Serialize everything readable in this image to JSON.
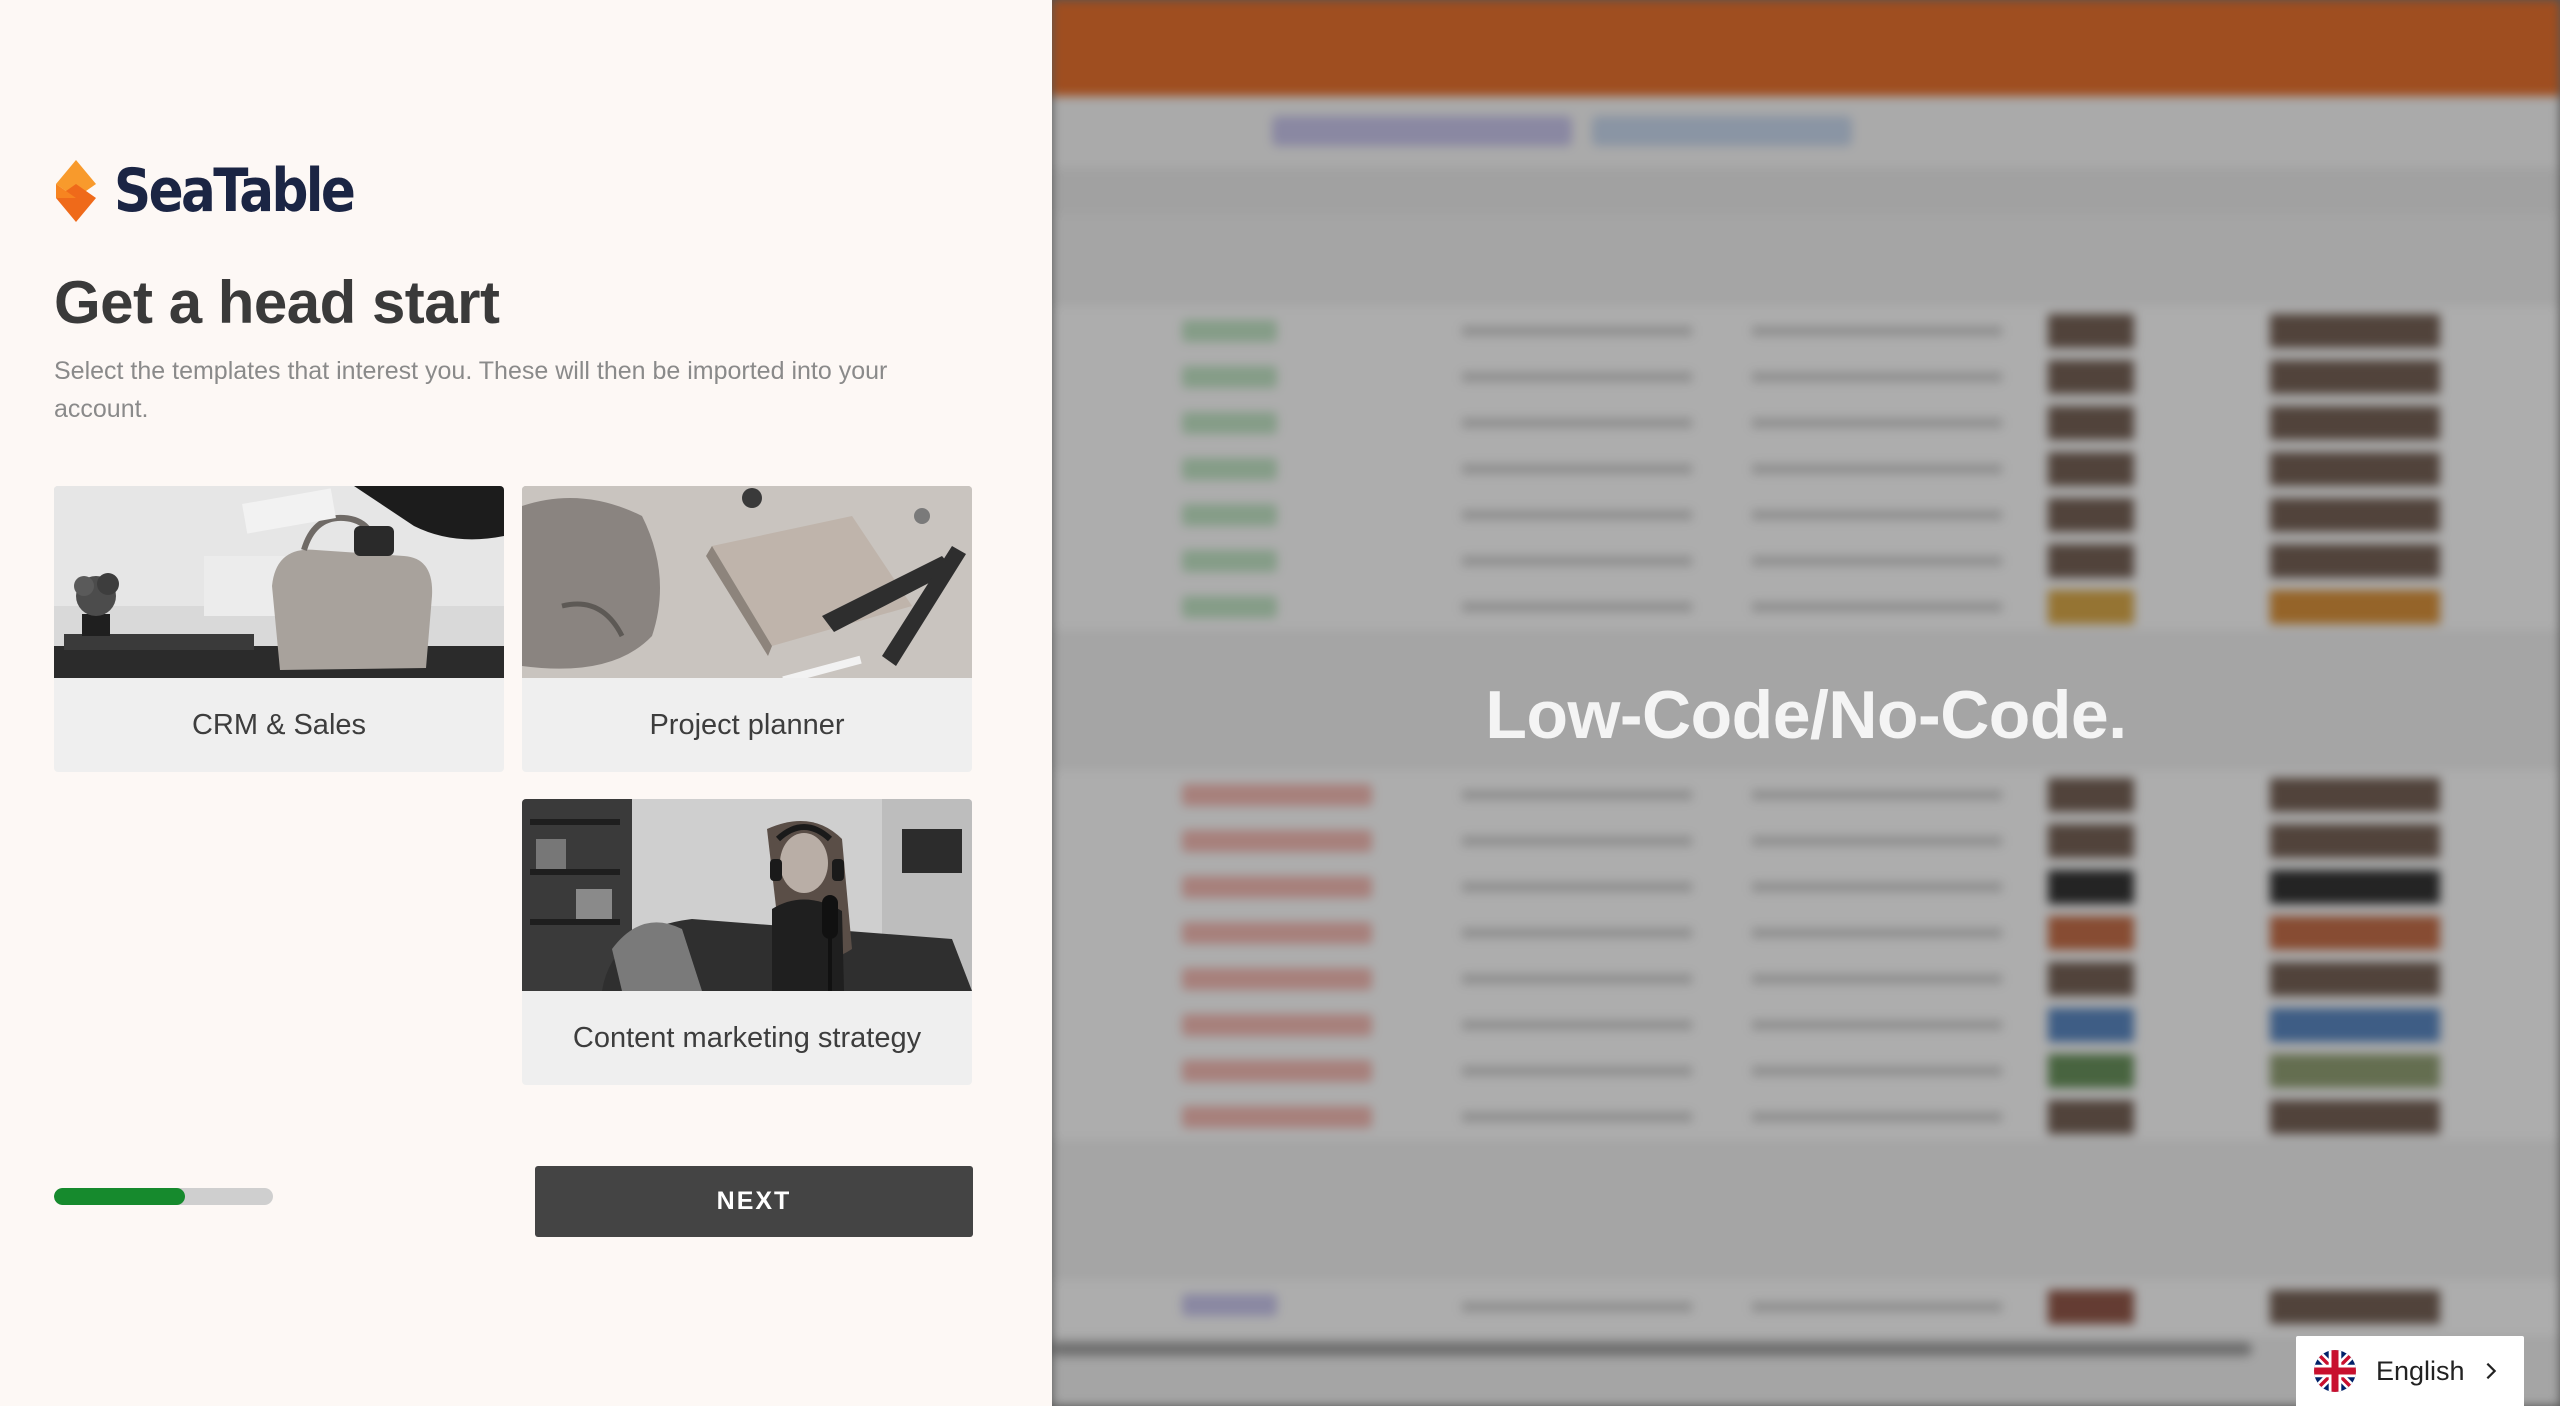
{
  "brand": {
    "name": "SeaTable"
  },
  "onboarding": {
    "title": "Get a head start",
    "subtitle": "Select the templates that interest you. These will then be imported into your account.",
    "templates": [
      {
        "label": "CRM & Sales",
        "selected": false
      },
      {
        "label": "Project planner",
        "selected": false
      },
      {
        "label": "Content marketing strategy",
        "selected": false
      }
    ],
    "progress_percent": 60,
    "next_label": "NEXT"
  },
  "promo": {
    "headline": "Low-Code/No-Code."
  },
  "language": {
    "selected": "English",
    "flag": "uk-flag-icon"
  },
  "colors": {
    "brand_orange": "#f68b1f",
    "brand_navy": "#1b2544",
    "progress_green": "#168a2d",
    "button_dark": "#444444",
    "app_header_orange": "#e9661c"
  }
}
